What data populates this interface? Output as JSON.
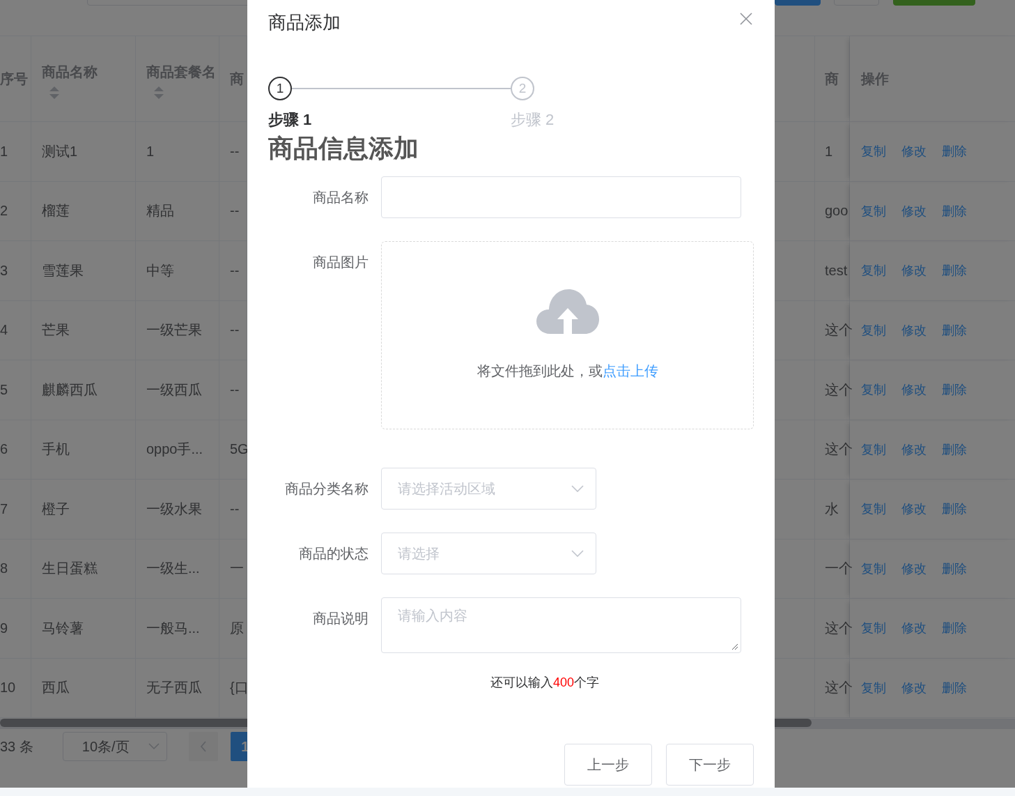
{
  "toolbar": {
    "buttons": [
      {
        "kind": "primary"
      },
      {
        "kind": "default"
      },
      {
        "kind": "success"
      }
    ]
  },
  "table": {
    "columns": [
      {
        "label": "序号",
        "sortable": false
      },
      {
        "label": "商品名称",
        "sortable": true
      },
      {
        "label": "商品套餐名",
        "sortable": true
      },
      {
        "label": "商",
        "sortable": false
      },
      {
        "label": "商",
        "sortable": false
      },
      {
        "label": "操作",
        "sortable": false
      }
    ],
    "rows": [
      {
        "seq": "1",
        "name": "测试1",
        "package": "1",
        "column_4": "--",
        "column_5": "1",
        "actions": [
          "复制",
          "修改",
          "删除"
        ]
      },
      {
        "seq": "2",
        "name": "榴莲",
        "package": "精品",
        "column_4": "--",
        "column_5": "goo",
        "actions": [
          "复制",
          "修改",
          "删除"
        ]
      },
      {
        "seq": "3",
        "name": "雪莲果",
        "package": "中等",
        "column_4": "--",
        "column_5": "test",
        "actions": [
          "复制",
          "修改",
          "删除"
        ]
      },
      {
        "seq": "4",
        "name": "芒果",
        "package": "一级芒果",
        "column_4": "--",
        "column_5": "这个",
        "actions": [
          "复制",
          "修改",
          "删除"
        ]
      },
      {
        "seq": "5",
        "name": "麒麟西瓜",
        "package": "一级西瓜",
        "column_4": "--",
        "column_5": "这个",
        "actions": [
          "复制",
          "修改",
          "删除"
        ]
      },
      {
        "seq": "6",
        "name": "手机",
        "package": "oppo手...",
        "column_4": "5G",
        "column_5": "这个",
        "actions": [
          "复制",
          "修改",
          "删除"
        ]
      },
      {
        "seq": "7",
        "name": "橙子",
        "package": "一级水果",
        "column_4": "--",
        "column_5": "水",
        "actions": [
          "复制",
          "修改",
          "删除"
        ]
      },
      {
        "seq": "8",
        "name": "生日蛋糕",
        "package": "一级生...",
        "column_4": "一",
        "column_5": "一个",
        "actions": [
          "复制",
          "修改",
          "删除"
        ]
      },
      {
        "seq": "9",
        "name": "马铃薯",
        "package": "一般马...",
        "column_4": "原",
        "column_5": "这个",
        "actions": [
          "复制",
          "修改",
          "删除"
        ]
      },
      {
        "seq": "10",
        "name": "西瓜",
        "package": "无子西瓜",
        "column_4": "{口",
        "column_5": "这个",
        "actions": [
          "复制",
          "修改",
          "删除"
        ]
      }
    ]
  },
  "pagination": {
    "total": "33 条",
    "page_size": "10条/页",
    "pages": [
      {
        "label": "1",
        "selected": true
      }
    ]
  },
  "dialog": {
    "title": "商品添加",
    "steps": [
      {
        "number": "1",
        "label": "步骤 1",
        "active": true
      },
      {
        "number": "2",
        "label": "步骤 2",
        "active": false
      }
    ],
    "section_title": "商品信息添加",
    "fields": [
      {
        "kind": "input",
        "label": "商品名称"
      },
      {
        "kind": "upload",
        "label": "商品图片",
        "text": "将文件拖到此处，或",
        "link": "点击上传"
      },
      {
        "kind": "select",
        "label": "商品分类名称",
        "placeholder": "请选择活动区域"
      },
      {
        "kind": "select",
        "label": "商品的状态",
        "placeholder": "请选择"
      },
      {
        "kind": "textarea",
        "label": "商品说明",
        "placeholder": "请输入内容"
      }
    ],
    "counter": {
      "prefix": "还可以输入",
      "count": "400",
      "suffix": "个字"
    },
    "buttons": [
      "上一步",
      "下一步"
    ]
  }
}
